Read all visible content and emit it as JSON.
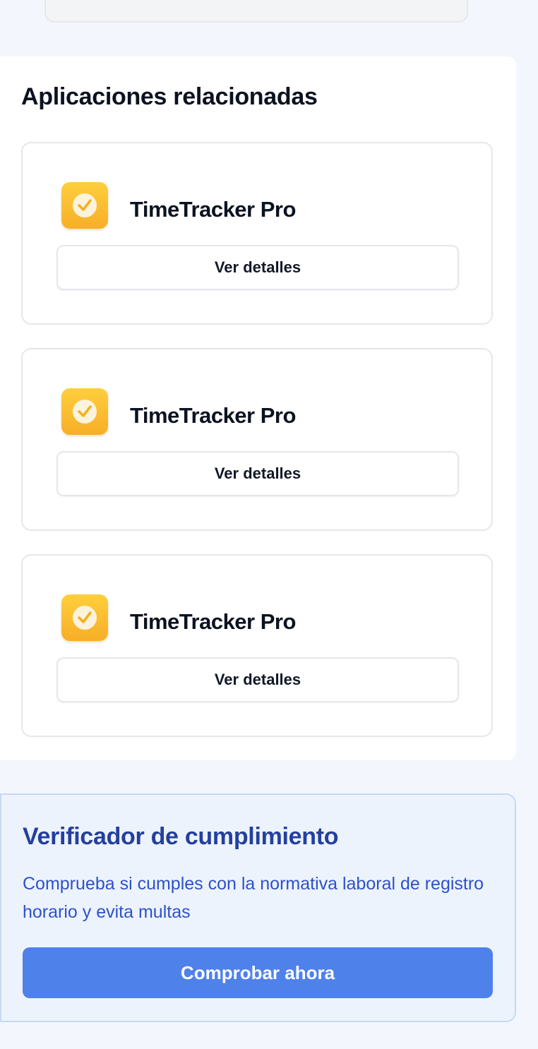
{
  "related_apps": {
    "title": "Aplicaciones relacionadas",
    "items": [
      {
        "name": "TimeTracker Pro",
        "icon": "clock-check-icon",
        "button_label": "Ver detalles"
      },
      {
        "name": "TimeTracker Pro",
        "icon": "clock-check-icon",
        "button_label": "Ver detalles"
      },
      {
        "name": "TimeTracker Pro",
        "icon": "clock-check-icon",
        "button_label": "Ver detalles"
      }
    ]
  },
  "compliance_checker": {
    "title": "Verificador de cumplimiento",
    "description": "Comprueba si cumples con la normativa laboral de registro horario y evita multas",
    "button_label": "Comprobar ahora"
  },
  "colors": {
    "app_icon": "#f7ae27",
    "accent_button": "#4f81ea",
    "compliance_title": "#24409e",
    "compliance_text": "#2e51cb"
  }
}
